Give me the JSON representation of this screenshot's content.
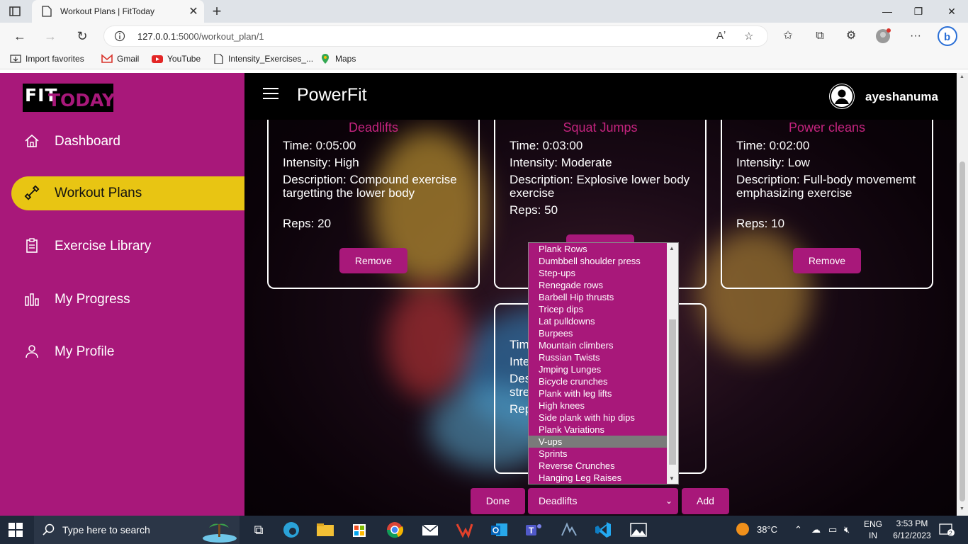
{
  "browser": {
    "tab_title": "Workout Plans | FitToday",
    "url_host": "127.0.0.1",
    "url_path": ":5000/workout_plan/1",
    "favorites": [
      {
        "label": "Import favorites"
      },
      {
        "label": "Gmail"
      },
      {
        "label": "YouTube"
      },
      {
        "label": "Intensity_Exercises_..."
      },
      {
        "label": "Maps"
      }
    ]
  },
  "sidebar": {
    "logo_fit": "FIT",
    "logo_today": "TODAY",
    "items": [
      {
        "label": "Dashboard",
        "icon": "home-icon"
      },
      {
        "label": "Workout Plans",
        "icon": "dumbbell-icon",
        "active": true
      },
      {
        "label": "Exercise Library",
        "icon": "clipboard-icon"
      },
      {
        "label": "My Progress",
        "icon": "bar-chart-icon"
      },
      {
        "label": "My Profile",
        "icon": "user-icon"
      }
    ]
  },
  "header": {
    "brand": "PowerFit",
    "username": "ayeshanuma"
  },
  "cards": [
    {
      "name": "Deadlifts",
      "time": "Time: 0:05:00",
      "intensity": "Intensity: High",
      "description": "Description: Compound exercise targetting the lower body",
      "reps": "Reps: 20",
      "button": "Remove"
    },
    {
      "name": "Squat Jumps",
      "time": "Time: 0:03:00",
      "intensity": "Intensity: Moderate",
      "description": "Description: Explosive lower body exercise",
      "reps": "Reps: 50"
    },
    {
      "name": "Power cleans",
      "time": "Time: 0:02:00",
      "intensity": "Intensity: Low",
      "description": "Description: Full-body movememt emphasizing exercise",
      "reps": "Reps: 10",
      "button": "Remove"
    },
    {
      "partial_lines": [
        "Tim",
        "Inte",
        "Des",
        "stre",
        "Rep"
      ]
    }
  ],
  "dropdown": {
    "options": [
      "Plank Rows",
      "Dumbbell shoulder press",
      "Step-ups",
      "Renegade rows",
      "Barbell Hip thrusts",
      "Tricep dips",
      "Lat pulldowns",
      "Burpees",
      "Mountain climbers",
      "Russian Twists",
      "Jmping Lunges",
      "Bicycle crunches",
      "Plank with leg lifts",
      "High knees",
      "Side plank with hip dips",
      "Plank Variations",
      "V-ups",
      "Sprints",
      "Reverse Crunches",
      "Hanging Leg Raises"
    ],
    "highlighted": "V-ups"
  },
  "controls": {
    "done": "Done",
    "selected": "Deadlifts",
    "add": "Add"
  },
  "taskbar": {
    "search_placeholder": "Type here to search",
    "weather": "38°C",
    "lang_top": "ENG",
    "lang_bottom": "IN",
    "time": "3:53 PM",
    "date": "6/12/2023",
    "notifications": "2"
  }
}
